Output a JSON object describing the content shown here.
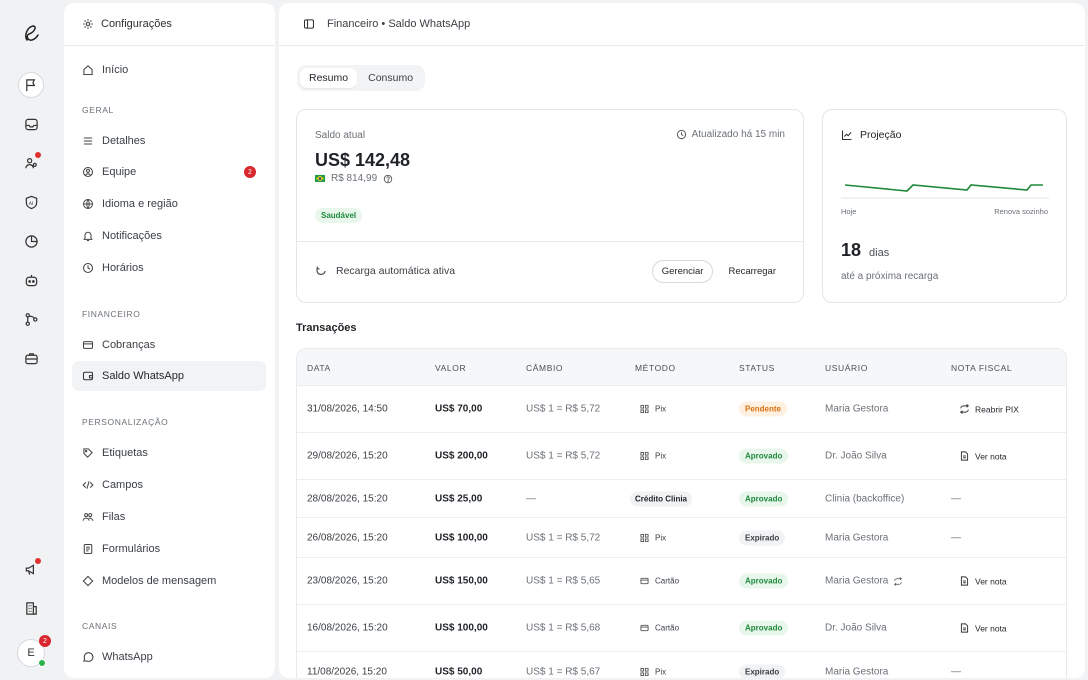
{
  "sidebar": {
    "header_label": "Configurações",
    "home": "Início",
    "sections": {
      "geral": "GERAL",
      "financeiro": "FINANCEIRO",
      "personalizacao": "PERSONALIZAÇÃO",
      "canais": "CANAIS"
    },
    "items": {
      "detalhes": "Detalhes",
      "equipe": "Equipe",
      "equipe_badge": "2",
      "idioma": "Idioma e região",
      "notificacoes": "Notificações",
      "horarios": "Horários",
      "cobrancas": "Cobranças",
      "saldo": "Saldo WhatsApp",
      "etiquetas": "Etiquetas",
      "campos": "Campos",
      "filas": "Filas",
      "formularios": "Formulários",
      "modelos": "Modelos de mensagem",
      "whatsapp": "WhatsApp"
    }
  },
  "rail": {
    "avatar_initial": "E",
    "avatar_badge": "2"
  },
  "header": {
    "breadcrumb": "Financeiro • Saldo WhatsApp"
  },
  "tabs": {
    "resumo": "Resumo",
    "consumo": "Consumo"
  },
  "balance": {
    "label": "Saldo atual",
    "updated": "Atualizado há 15 min",
    "amount": "US$ 142,48",
    "brl": "R$ 814,99",
    "status": "Saudável",
    "auto_recharge": "Recarga automática ativa",
    "manage": "Gerenciar",
    "recharge": "Recarregar"
  },
  "projection": {
    "title": "Projeção",
    "start_label": "Hoje",
    "end_label": "Renova sozinho",
    "days": "18",
    "days_unit": "dias",
    "subtitle": "até a próxima recarga"
  },
  "transactions": {
    "title": "Transações",
    "columns": [
      "DATA",
      "VALOR",
      "CÂMBIO",
      "MÉTODO",
      "STATUS",
      "USUÁRIO",
      "NOTA FISCAL"
    ],
    "rows": [
      {
        "date": "31/08/2026, 14:50",
        "value": "US$ 70,00",
        "rate": "US$ 1 = R$ 5,72",
        "method": "Pix",
        "status": "Pendente",
        "user": "Maria Gestora",
        "nf": "Reabrir PIX"
      },
      {
        "date": "29/08/2026, 15:20",
        "value": "US$ 200,00",
        "rate": "US$ 1 = R$ 5,72",
        "method": "Pix",
        "status": "Aprovado",
        "user": "Dr. João Silva",
        "nf": "Ver nota"
      },
      {
        "date": "28/08/2026, 15:20",
        "value": "US$ 25,00",
        "rate": "—",
        "method": "Crédito Clinia",
        "status": "Aprovado",
        "user": "Clinia (backoffice)",
        "nf": "—"
      },
      {
        "date": "26/08/2026, 15:20",
        "value": "US$ 100,00",
        "rate": "US$ 1 = R$ 5,72",
        "method": "Pix",
        "status": "Expirado",
        "user": "Maria Gestora",
        "nf": "—"
      },
      {
        "date": "23/08/2026, 15:20",
        "value": "US$ 150,00",
        "rate": "US$ 1 = R$ 5,65",
        "method": "Cartão",
        "status": "Aprovado",
        "user": "Maria Gestora",
        "nf": "Ver nota"
      },
      {
        "date": "16/08/2026, 15:20",
        "value": "US$ 100,00",
        "rate": "US$ 1 = R$ 5,68",
        "method": "Cartão",
        "status": "Aprovado",
        "user": "Dr. João Silva",
        "nf": "Ver nota"
      },
      {
        "date": "11/08/2026, 15:20",
        "value": "US$ 50,00",
        "rate": "US$ 1 = R$ 5,67",
        "method": "Pix",
        "status": "Expirado",
        "user": "Maria Gestora",
        "nf": "—"
      }
    ]
  },
  "colors": {
    "accent_green": "#1f8a3b",
    "pending_orange": "#d8700c",
    "alert_red": "#d9272e"
  }
}
